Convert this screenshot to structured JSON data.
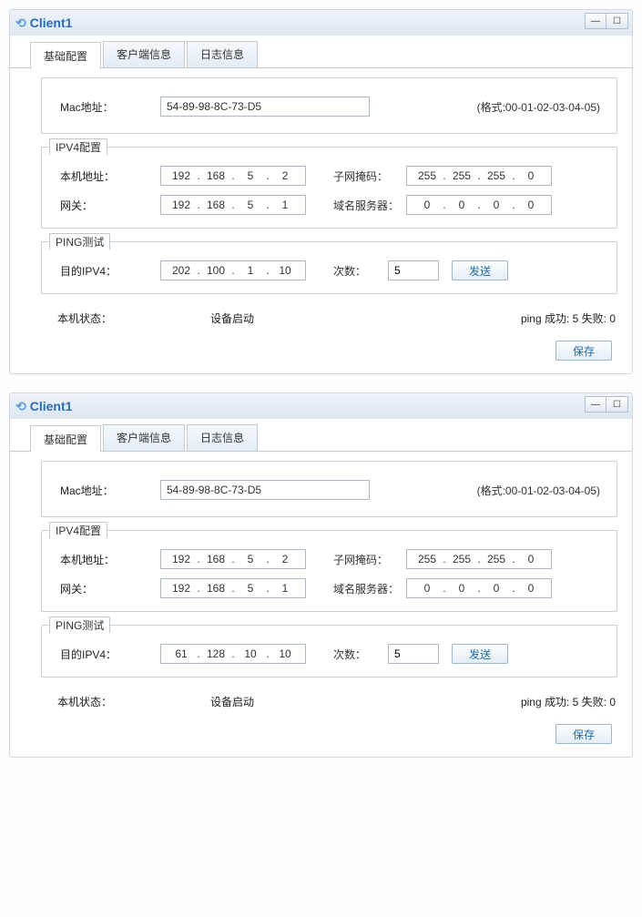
{
  "windows": [
    {
      "title": "Client1",
      "tabs": {
        "basic": "基础配置",
        "client": "客户端信息",
        "log": "日志信息"
      },
      "mac": {
        "label": "Mac地址：",
        "value": "54-89-98-8C-73-D5",
        "hint": "(格式:00-01-02-03-04-05)"
      },
      "ipv4": {
        "legend": "IPV4配置",
        "host_label": "本机地址：",
        "host_ip": [
          "192",
          "168",
          "5",
          "2"
        ],
        "mask_label": "子网掩码：",
        "mask_ip": [
          "255",
          "255",
          "255",
          "0"
        ],
        "gw_label": "网关：",
        "gw_ip": [
          "192",
          "168",
          "5",
          "1"
        ],
        "dns_label": "域名服务器：",
        "dns_ip": [
          "0",
          "0",
          "0",
          "0"
        ]
      },
      "ping": {
        "legend": "PING测试",
        "dest_label": "目的IPV4：",
        "dest_ip": [
          "202",
          "100",
          "1",
          "10"
        ],
        "count_label": "次数：",
        "count_value": "5",
        "send_label": "发送"
      },
      "status": {
        "host_label": "本机状态：",
        "host_value": "设备启动",
        "ping_result": "ping 成功:  5    失败:  0"
      },
      "save_label": "保存"
    },
    {
      "title": "Client1",
      "tabs": {
        "basic": "基础配置",
        "client": "客户端信息",
        "log": "日志信息"
      },
      "mac": {
        "label": "Mac地址：",
        "value": "54-89-98-8C-73-D5",
        "hint": "(格式:00-01-02-03-04-05)"
      },
      "ipv4": {
        "legend": "IPV4配置",
        "host_label": "本机地址：",
        "host_ip": [
          "192",
          "168",
          "5",
          "2"
        ],
        "mask_label": "子网掩码：",
        "mask_ip": [
          "255",
          "255",
          "255",
          "0"
        ],
        "gw_label": "网关：",
        "gw_ip": [
          "192",
          "168",
          "5",
          "1"
        ],
        "dns_label": "域名服务器：",
        "dns_ip": [
          "0",
          "0",
          "0",
          "0"
        ]
      },
      "ping": {
        "legend": "PING测试",
        "dest_label": "目的IPV4：",
        "dest_ip": [
          "61",
          "128",
          "10",
          "10"
        ],
        "count_label": "次数：",
        "count_value": "5",
        "send_label": "发送"
      },
      "status": {
        "host_label": "本机状态：",
        "host_value": "设备启动",
        "ping_result": "ping 成功:  5    失败:  0"
      },
      "save_label": "保存"
    }
  ]
}
